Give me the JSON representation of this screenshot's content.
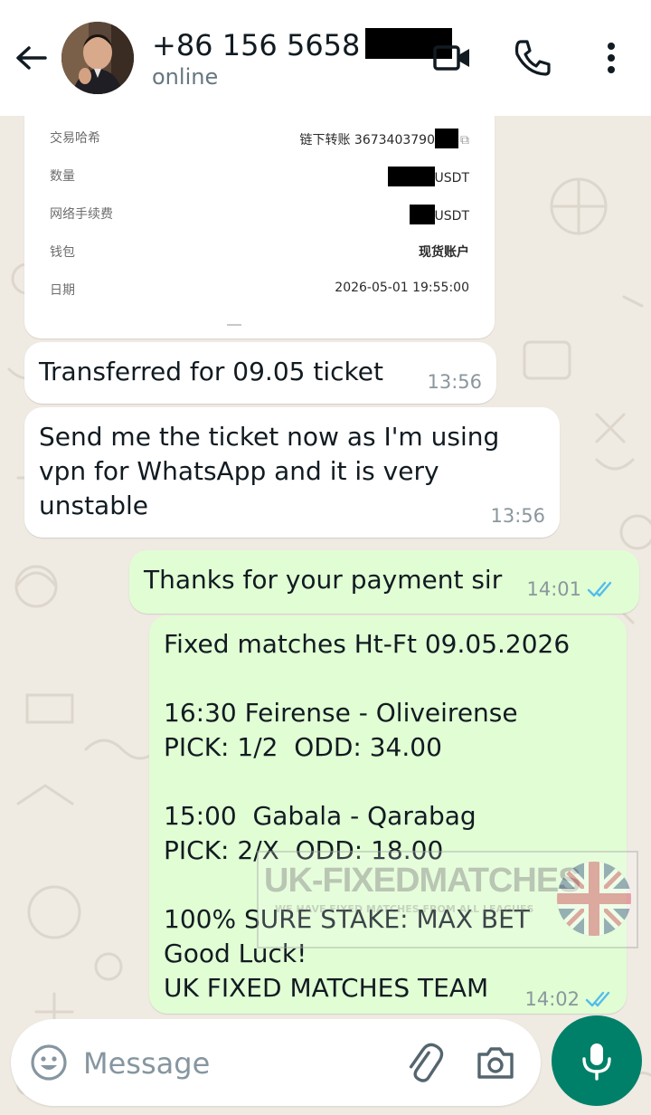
{
  "header": {
    "contact_name": "+86 156 5658",
    "status": "online",
    "icons": [
      "back-arrow-icon",
      "video-call-icon",
      "phone-icon",
      "more-options-icon"
    ]
  },
  "receipt": {
    "rows": [
      {
        "label": "交易哈希",
        "value": "链下转账 3673403790"
      },
      {
        "label": "数量",
        "value": "USDT"
      },
      {
        "label": "网络手续费",
        "value": "USDT"
      },
      {
        "label": "钱包",
        "value": "现货账户"
      },
      {
        "label": "日期",
        "value": "2026-05-01 19:55:00"
      }
    ]
  },
  "messages": [
    {
      "direction": "incoming",
      "text": "Transferred for 09.05 ticket",
      "time": "13:56"
    },
    {
      "direction": "incoming",
      "text": "Send me the ticket now as I'm using\nvpn for WhatsApp and it is very\nunstable",
      "time": "13:56"
    },
    {
      "direction": "outgoing",
      "text": "Thanks for your payment sir",
      "time": "14:01",
      "status": "read"
    },
    {
      "direction": "outgoing",
      "text": "Fixed matches Ht-Ft 09.05.2026\n\n16:30 Feirense - Oliveirense\nPICK: 1/2  ODD: 34.00\n\n15:00  Gabala - Qarabag\nPICK: 2/X  ODD: 18.00\n\n100% SURE STAKE: MAX BET\nGood Luck!\nUK FIXED MATCHES TEAM",
      "time": "14:02",
      "status": "read"
    }
  ],
  "watermark": {
    "title": "UK-FIXEDMATCHES",
    "subtitle": "WE HAVE FIXED MATCHES FROM ALL LEAGUES"
  },
  "input": {
    "placeholder": "Message"
  },
  "colors": {
    "header_bg": "#ffffff",
    "chat_bg": "#efeae2",
    "outgoing_bubble": "#e1fdd4",
    "incoming_bubble": "#ffffff",
    "read_tick": "#53bdeb",
    "mic_button": "#008069"
  }
}
